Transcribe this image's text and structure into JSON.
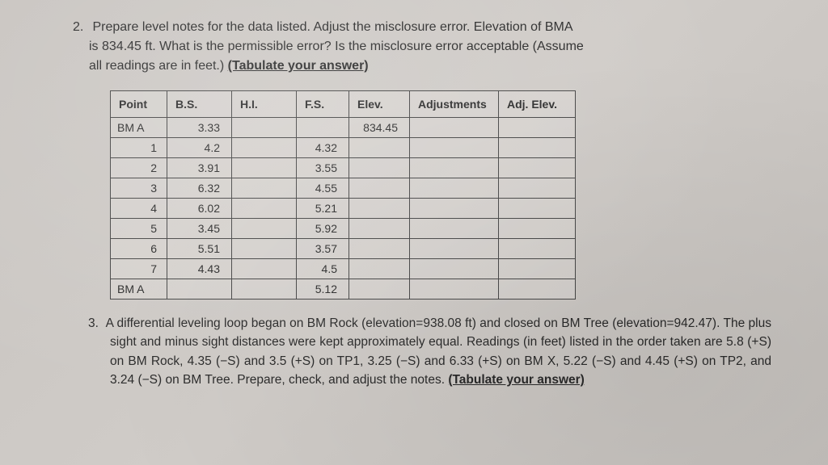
{
  "q2": {
    "number": "2.",
    "line1": "Prepare level notes for the data listed. Adjust the misclosure error. Elevation of BMA",
    "line2": "is 834.45 ft. What is the permissible error? Is the misclosure error acceptable (Assume",
    "line3": "all readings are in feet.) ",
    "tabulate": "(Tabulate your answer)"
  },
  "table": {
    "headers": {
      "point": "Point",
      "bs": "B.S.",
      "hi": "H.I.",
      "fs": "F.S.",
      "elev": "Elev.",
      "adj": "Adjustments",
      "adjelev": "Adj. Elev."
    },
    "rows": [
      {
        "point": "BM A",
        "bs": "3.33",
        "hi": "",
        "fs": "",
        "elev": "834.45",
        "adj": "",
        "adjelev": "",
        "align": "left"
      },
      {
        "point": "1",
        "bs": "4.2",
        "hi": "",
        "fs": "4.32",
        "elev": "",
        "adj": "",
        "adjelev": "",
        "align": "right"
      },
      {
        "point": "2",
        "bs": "3.91",
        "hi": "",
        "fs": "3.55",
        "elev": "",
        "adj": "",
        "adjelev": "",
        "align": "right"
      },
      {
        "point": "3",
        "bs": "6.32",
        "hi": "",
        "fs": "4.55",
        "elev": "",
        "adj": "",
        "adjelev": "",
        "align": "right"
      },
      {
        "point": "4",
        "bs": "6.02",
        "hi": "",
        "fs": "5.21",
        "elev": "",
        "adj": "",
        "adjelev": "",
        "align": "right"
      },
      {
        "point": "5",
        "bs": "3.45",
        "hi": "",
        "fs": "5.92",
        "elev": "",
        "adj": "",
        "adjelev": "",
        "align": "right"
      },
      {
        "point": "6",
        "bs": "5.51",
        "hi": "",
        "fs": "3.57",
        "elev": "",
        "adj": "",
        "adjelev": "",
        "align": "right"
      },
      {
        "point": "7",
        "bs": "4.43",
        "hi": "",
        "fs": "4.5",
        "elev": "",
        "adj": "",
        "adjelev": "",
        "align": "right"
      },
      {
        "point": "BM A",
        "bs": "",
        "hi": "",
        "fs": "5.12",
        "elev": "",
        "adj": "",
        "adjelev": "",
        "align": "left"
      }
    ]
  },
  "q3": {
    "number": "3.",
    "text": "A differential leveling loop began on BM Rock (elevation=938.08 ft) and closed on BM Tree (elevation=942.47). The plus sight and minus sight distances were kept approximately equal. Readings (in feet) listed in the order taken are 5.8 (+S) on BM Rock, 4.35 (−S) and 3.5 (+S) on TP1, 3.25 (−S) and 6.33 (+S) on BM X, 5.22 (−S) and 4.45 (+S) on TP2, and 3.24 (−S) on BM Tree. Prepare, check, and adjust the notes. ",
    "tabulate": "(Tabulate your answer)"
  }
}
